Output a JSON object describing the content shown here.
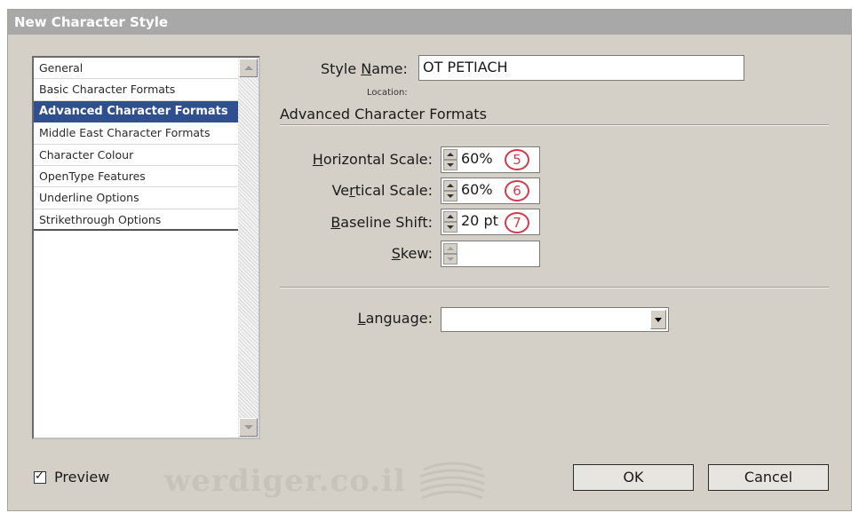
{
  "window": {
    "title": "New Character Style"
  },
  "sidebar": {
    "items": [
      {
        "label": "General",
        "selected": false
      },
      {
        "label": "Basic Character Formats",
        "selected": false
      },
      {
        "label": "Advanced Character Formats",
        "selected": true
      },
      {
        "label": "Middle East Character Formats",
        "selected": false
      },
      {
        "label": "Character Colour",
        "selected": false
      },
      {
        "label": "OpenType Features",
        "selected": false
      },
      {
        "label": "Underline Options",
        "selected": false
      },
      {
        "label": "Strikethrough Options",
        "selected": false
      }
    ]
  },
  "style_name": {
    "label_pre": "Style ",
    "label_accel": "N",
    "label_post": "ame:",
    "value": "OT PETIACH"
  },
  "location": {
    "label": "Location:"
  },
  "section": {
    "title": "Advanced Character Formats"
  },
  "fields": {
    "horizontal_scale": {
      "label_accel": "H",
      "label_post": "orizontal Scale:",
      "value": "60%",
      "badge": "5"
    },
    "vertical_scale": {
      "label_pre": "Ve",
      "label_accel": "r",
      "label_post": "tical Scale:",
      "value": "60%",
      "badge": "6"
    },
    "baseline_shift": {
      "label_accel": "B",
      "label_post": "aseline Shift:",
      "value": "20 pt",
      "badge": "7"
    },
    "skew": {
      "label_accel": "S",
      "label_post": "kew:",
      "value": ""
    }
  },
  "language": {
    "label_accel": "L",
    "label_post": "anguage:",
    "value": ""
  },
  "preview": {
    "label": "Preview",
    "checked": true,
    "check_glyph": "✓"
  },
  "watermark": {
    "text": "werdiger.co.il"
  },
  "buttons": {
    "ok": "OK",
    "cancel": "Cancel"
  },
  "colors": {
    "selection": "#2f4f8f",
    "annotation": "#d23a4a",
    "dialog_bg": "#d4d0c8",
    "titlebar": "#a8a8a8"
  }
}
